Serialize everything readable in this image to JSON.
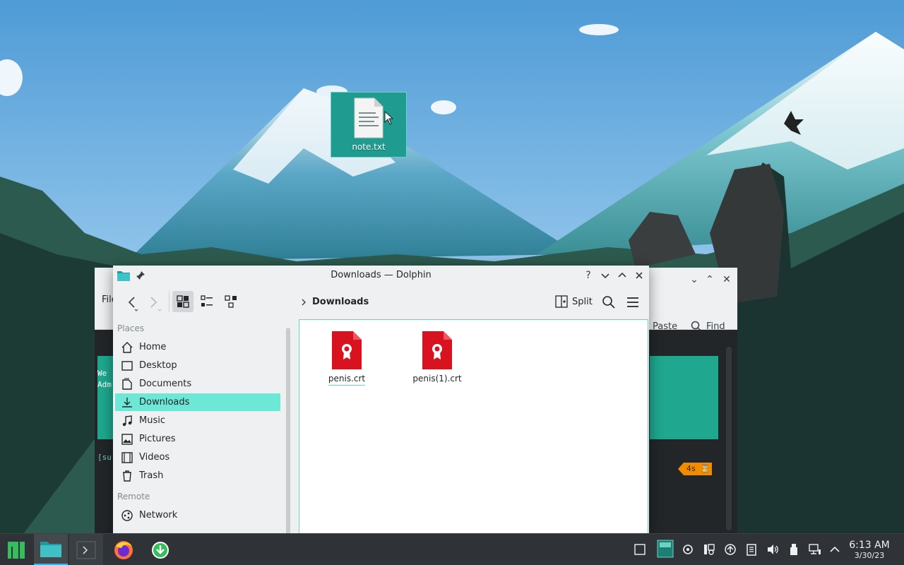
{
  "desktop": {
    "icon_label": "note.txt"
  },
  "terminal": {
    "menu_partial": "File",
    "paste_label": "Paste",
    "find_label": "Find",
    "line1": "We",
    "line2": "Adm",
    "prompt": "[su",
    "timer_badge": "4s ⌛"
  },
  "dolphin": {
    "title": "Downloads — Dolphin",
    "breadcrumb": "Downloads",
    "split_label": "Split",
    "places_heading": "Places",
    "remote_heading": "Remote",
    "places": [
      {
        "label": "Home",
        "icon": "home-icon"
      },
      {
        "label": "Desktop",
        "icon": "desktop-icon"
      },
      {
        "label": "Documents",
        "icon": "documents-icon"
      },
      {
        "label": "Downloads",
        "icon": "downloads-icon",
        "active": true
      },
      {
        "label": "Music",
        "icon": "music-icon"
      },
      {
        "label": "Pictures",
        "icon": "pictures-icon"
      },
      {
        "label": "Videos",
        "icon": "videos-icon"
      },
      {
        "label": "Trash",
        "icon": "trash-icon"
      }
    ],
    "remote": [
      {
        "label": "Network",
        "icon": "network-icon"
      }
    ],
    "files": [
      {
        "name": "penis.crt",
        "icon": "certificate-icon"
      },
      {
        "name": "penis(1).crt",
        "icon": "certificate-icon"
      }
    ]
  },
  "taskbar": {
    "time": "6:13 AM",
    "date": "3/30/23",
    "apps": [
      "application-launcher",
      "dolphin",
      "konsole",
      "firefox",
      "software-update"
    ]
  },
  "colors": {
    "accent": "#1fa88f",
    "selection": "#6ee8d6",
    "panel": "#2f3337",
    "window": "#eff0f1",
    "crt_red": "#d8121e"
  }
}
